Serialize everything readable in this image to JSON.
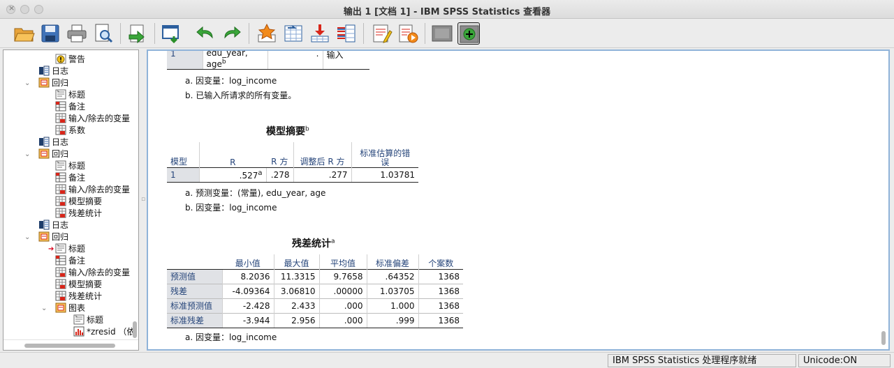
{
  "window": {
    "title": "输出 1 [文档 1] - IBM SPSS Statistics 查看器"
  },
  "toolbar": {
    "buttons": [
      "open-icon",
      "save-icon",
      "print-icon",
      "print-preview-icon",
      "export-icon",
      "recall-dialog-icon",
      "undo-icon",
      "redo-icon",
      "goto-case-icon",
      "goto-variable-icon",
      "insert-output-icon",
      "variables-icon",
      "script-icon",
      "run-script-icon",
      "hide-icon",
      "show-icon"
    ]
  },
  "outline": {
    "items": [
      {
        "label": "警告",
        "icon": "warning-icon",
        "level": 3
      },
      {
        "label": "日志",
        "icon": "log-icon",
        "level": 2
      },
      {
        "label": "回归",
        "icon": "procedure-icon",
        "level": 2,
        "expanded": true
      },
      {
        "label": "标题",
        "icon": "title-icon",
        "level": 3
      },
      {
        "label": "备注",
        "icon": "notes-icon",
        "level": 3
      },
      {
        "label": "输入/除去的变量",
        "icon": "table-icon",
        "level": 3
      },
      {
        "label": "系数",
        "icon": "table-icon",
        "level": 3
      },
      {
        "label": "日志",
        "icon": "log-icon",
        "level": 2
      },
      {
        "label": "回归",
        "icon": "procedure-icon",
        "level": 2,
        "expanded": true
      },
      {
        "label": "标题",
        "icon": "title-icon",
        "level": 3
      },
      {
        "label": "备注",
        "icon": "notes-icon",
        "level": 3
      },
      {
        "label": "输入/除去的变量",
        "icon": "table-icon",
        "level": 3
      },
      {
        "label": "模型摘要",
        "icon": "table-icon",
        "level": 3
      },
      {
        "label": "残差统计",
        "icon": "table-icon",
        "level": 3
      },
      {
        "label": "日志",
        "icon": "log-icon",
        "level": 2
      },
      {
        "label": "回归",
        "icon": "procedure-icon",
        "level": 2,
        "expanded": true
      },
      {
        "label": "标题",
        "icon": "title-icon",
        "level": 3,
        "current": true
      },
      {
        "label": "备注",
        "icon": "notes-icon",
        "level": 3
      },
      {
        "label": "输入/除去的变量",
        "icon": "table-icon",
        "level": 3
      },
      {
        "label": "模型摘要",
        "icon": "table-icon",
        "level": 3
      },
      {
        "label": "残差统计",
        "icon": "table-icon",
        "level": 3
      },
      {
        "label": "图表",
        "icon": "procedure-icon",
        "level": 3,
        "expanded": true
      },
      {
        "label": "标题",
        "icon": "title-icon",
        "level": 4
      },
      {
        "label": "*zresid （依",
        "icon": "chart-icon",
        "level": 4
      }
    ]
  },
  "viewer": {
    "partial_table": {
      "row_num": "1",
      "vars_line1": "edu_year,",
      "vars_line2": "age",
      "vars_sup": "b",
      "removed": ".",
      "method": "输入"
    },
    "notes1": {
      "a": "a. 因变量：log_income",
      "b": "b. 已输入所请求的所有变量。"
    },
    "model_summary": {
      "title": "模型摘要",
      "title_sup": "b",
      "headers": [
        "模型",
        "R",
        "R 方",
        "调整后 R 方",
        "标准估算的错误"
      ],
      "header_last_line1": "标准估算的错",
      "header_last_line2": "误",
      "row": {
        "model": "1",
        "r": ".527",
        "r_sup": "a",
        "r2": ".278",
        "adj_r2": ".277",
        "se": "1.03781"
      },
      "note_a": "a. 预测变量：(常量), edu_year, age",
      "note_b": "b. 因变量：log_income"
    },
    "residuals": {
      "title": "残差统计",
      "title_sup": "a",
      "headers": [
        "最小值",
        "最大值",
        "平均值",
        "标准偏差",
        "个案数"
      ],
      "rows": [
        {
          "label": "预测值",
          "min": "8.2036",
          "max": "11.3315",
          "mean": "9.7658",
          "sd": ".64352",
          "n": "1368"
        },
        {
          "label": "残差",
          "min": "-4.09364",
          "max": "3.06810",
          "mean": ".00000",
          "sd": "1.03705",
          "n": "1368"
        },
        {
          "label": "标准预测值",
          "min": "-2.428",
          "max": "2.433",
          "mean": ".000",
          "sd": "1.000",
          "n": "1368"
        },
        {
          "label": "标准残差",
          "min": "-3.944",
          "max": "2.956",
          "mean": ".000",
          "sd": ".999",
          "n": "1368"
        }
      ],
      "note_a": "a. 因变量：log_income"
    }
  },
  "status": {
    "processor": "IBM SPSS Statistics 处理程序就绪",
    "unicode": "Unicode:ON"
  }
}
